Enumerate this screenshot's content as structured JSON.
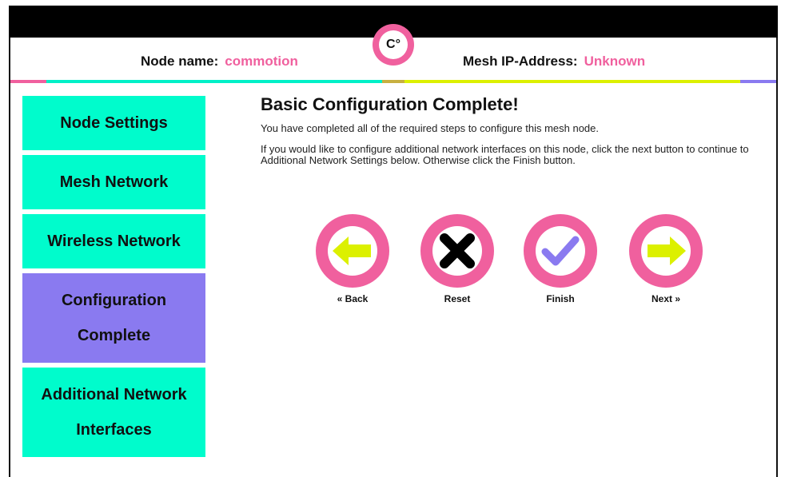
{
  "header": {
    "node_name_label": "Node name:",
    "node_name_value": "commotion",
    "mesh_ip_label": "Mesh IP-Address:",
    "mesh_ip_value": "Unknown",
    "logo_text": "C°"
  },
  "sidebar": {
    "items": [
      {
        "label": "Node Settings"
      },
      {
        "label": "Mesh Network"
      },
      {
        "label": "Wireless Network"
      },
      {
        "label_line1": "Configuration",
        "label_line2": "Complete"
      },
      {
        "label_line1": "Additional Network",
        "label_line2": "Interfaces"
      }
    ]
  },
  "main": {
    "title": "Basic Configuration Complete!",
    "paragraph1": "You have completed all of the required steps to configure this mesh node.",
    "paragraph2": "If you would like to configure additional network interfaces on this node, click the next button to continue to Additional Network Settings below. Otherwise click the Finish button."
  },
  "buttons": {
    "back": "« Back",
    "reset": "Reset",
    "finish": "Finish",
    "next": "Next »"
  },
  "colors": {
    "accent_pink": "#f0609e",
    "teal": "#00fccc",
    "purple": "#8a7af0",
    "yellow": "#dcf000"
  }
}
